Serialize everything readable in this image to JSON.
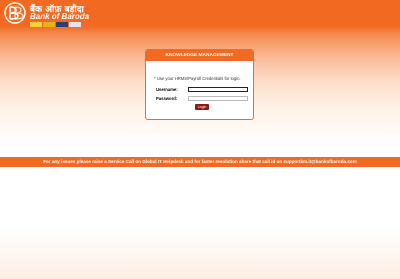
{
  "header": {
    "brand_hindi": "बैंक ऑफ़ बड़ौदा",
    "brand_english": "Bank of Baroda",
    "logo_icon": "bob-logo-icon",
    "colors": {
      "primary": "#f26a21",
      "dark": "#8b1a10"
    }
  },
  "login_panel": {
    "title": "KNOWLEDGE MANAGEMENT",
    "instruction": "* Use your HRMS/Payroll Credentials for login.",
    "username_label": "Username:",
    "password_label": "Password:",
    "username_value": "",
    "password_value": "",
    "login_button": "Login"
  },
  "footer": {
    "notice": "For any issues please raise a Service Call on Global IT Helpdesk and for faster resolution share that call id on supportkm.it@bankofbaroda.com"
  }
}
